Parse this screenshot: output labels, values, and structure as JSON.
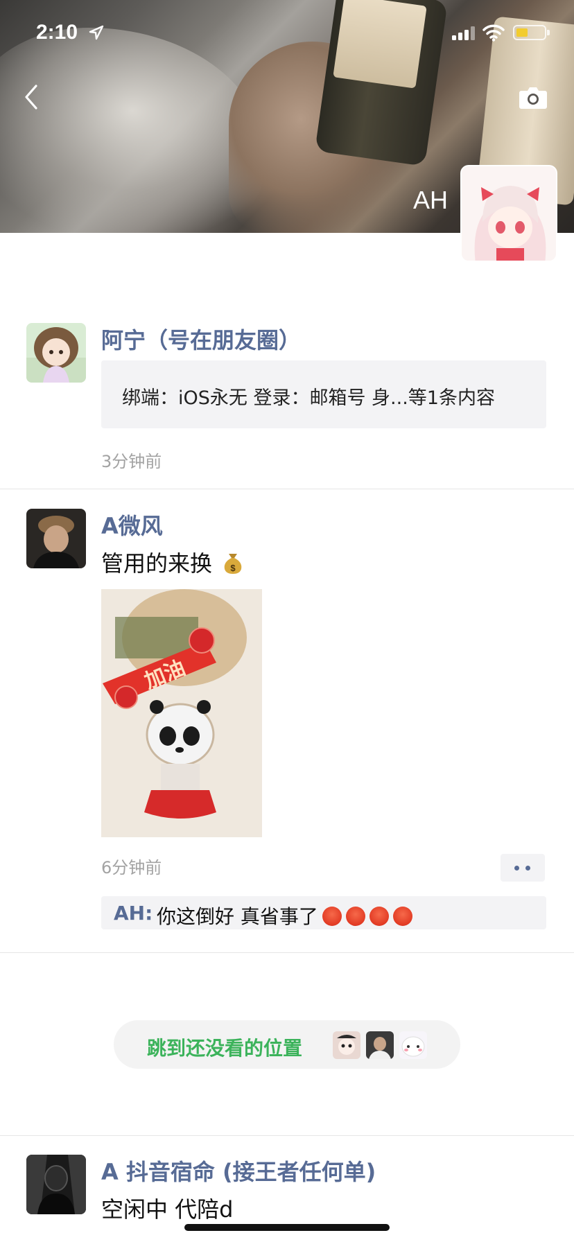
{
  "status_bar": {
    "time": "2:10"
  },
  "header": {
    "owner_name": "AH"
  },
  "feed": [
    {
      "author": "阿宁（号在朋友圈）",
      "share_text": "绑端：iOS永无 登录：邮箱号 身...等1条内容",
      "time_ago": "3分钟前"
    },
    {
      "author": "A微风",
      "text": "管用的来换",
      "text_emoji": "money-bag",
      "photo_caption": "加油",
      "time_ago": "6分钟前",
      "comment": {
        "author": "AH",
        "separator": ":",
        "text": "你这倒好 真省事了",
        "emoji_count": 4
      }
    },
    {
      "author": "A 抖音宿命 (接王者任何单)",
      "text": "空闲中 代陪d"
    }
  ],
  "jump_pill": {
    "label": "跳到还没看的位置"
  },
  "colors": {
    "link_blue": "#576b95",
    "green": "#3cb35b",
    "meta_gray": "#a3a3a3",
    "bubble_bg": "#f3f3f5"
  }
}
